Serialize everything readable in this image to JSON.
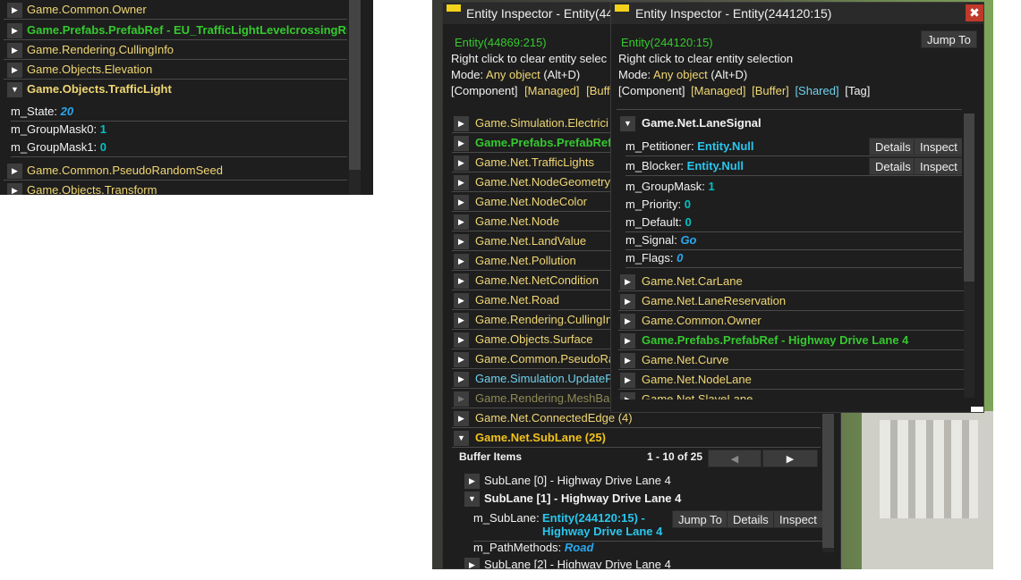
{
  "left_panel": {
    "rows": [
      {
        "label": "Game.Common.Owner"
      },
      {
        "label": "Game.Prefabs.PrefabRef - EU_TrafficLightLevelcrossingRi"
      },
      {
        "label": "Game.Rendering.CullingInfo"
      },
      {
        "label": "Game.Objects.Elevation"
      },
      {
        "label": "Game.Objects.TrafficLight"
      }
    ],
    "fields": [
      {
        "name": "m_State:",
        "value": "20"
      },
      {
        "name": "m_GroupMask0:",
        "value": "1"
      },
      {
        "name": "m_GroupMask1:",
        "value": "0"
      }
    ],
    "rows_after": [
      {
        "label": "Game.Common.PseudoRandomSeed"
      },
      {
        "label": "Game.Objects.Transform"
      }
    ]
  },
  "back_inspector": {
    "title": "Entity Inspector - Entity(44",
    "entity": "Entity(44869:215)",
    "hint": "Right click to clear entity selec",
    "mode_prefix": "Mode: ",
    "mode_value": "Any object",
    "mode_suffix": " (Alt+D)",
    "filters": [
      "[Component]",
      "[Managed]",
      "[Buff"
    ],
    "components": [
      "Game.Simulation.Electrici",
      "Game.Prefabs.PrefabRef",
      "Game.Net.TrafficLights",
      "Game.Net.NodeGeometry",
      "Game.Net.NodeColor",
      "Game.Net.Node",
      "Game.Net.LandValue",
      "Game.Net.Pollution",
      "Game.Net.NetCondition",
      "Game.Net.Road",
      "Game.Rendering.CullingIn",
      "Game.Objects.Surface",
      "Game.Common.PseudoRa",
      "Game.Simulation.UpdateF",
      "Game.Rendering.MeshBa",
      "Game.Net.ConnectedEdge (4)",
      "Game.Net.SubLane (25)"
    ],
    "buffer": {
      "label": "Buffer Items",
      "page": "1 - 10 of 25",
      "prev_icon": "◀",
      "next_icon": "▶",
      "items": [
        "SubLane [0] - Highway Drive Lane 4",
        "SubLane [1] - Highway Drive Lane 4"
      ],
      "sublane_field": "m_SubLane:",
      "sublane_value_1": "Entity(244120:15)  -",
      "sublane_value_2": "Highway Drive Lane 4",
      "jump_to": "Jump To",
      "details": "Details",
      "inspect": "Inspect",
      "path_field": "m_PathMethods:",
      "path_value": "Road",
      "last_item": "SubLane [2] - Highway Drive Lane 4"
    }
  },
  "front_inspector": {
    "title": "Entity Inspector - Entity(244120:15)",
    "close_icon": "✖",
    "entity": "Entity(244120:15)",
    "jump_to": "Jump To",
    "hint": "Right click to clear entity selection",
    "mode_prefix": "Mode: ",
    "mode_value": "Any object",
    "mode_suffix": " (Alt+D)",
    "filters": [
      "[Component]",
      "[Managed]",
      "[Buffer]",
      "[Shared]",
      "[Tag]"
    ],
    "lane_signal": {
      "label": "Game.Net.LaneSignal",
      "petitioner_name": "m_Petitioner:",
      "petitioner_value": "Entity.Null",
      "blocker_name": "m_Blocker:",
      "blocker_value": "Entity.Null",
      "details": "Details",
      "inspect": "Inspect",
      "fields": [
        {
          "name": "m_GroupMask:",
          "value": "1"
        },
        {
          "name": "m_Priority:",
          "value": "0"
        },
        {
          "name": "m_Default:",
          "value": "0"
        }
      ],
      "signal_name": "m_Signal:",
      "signal_value": "Go",
      "flags_name": "m_Flags:",
      "flags_value": "0"
    },
    "components": [
      "Game.Net.CarLane",
      "Game.Net.LaneReservation",
      "Game.Common.Owner",
      "Game.Prefabs.PrefabRef - Highway Drive Lane 4",
      "Game.Net.Curve",
      "Game.Net.NodeLane",
      "Game.Net.SlaveLane"
    ]
  },
  "colors": {
    "panel_bg": "#1e1e1e",
    "yellow": "#f0d774",
    "green": "#35c92f",
    "cyan": "#29c6ee",
    "close_red": "#c0392b"
  }
}
